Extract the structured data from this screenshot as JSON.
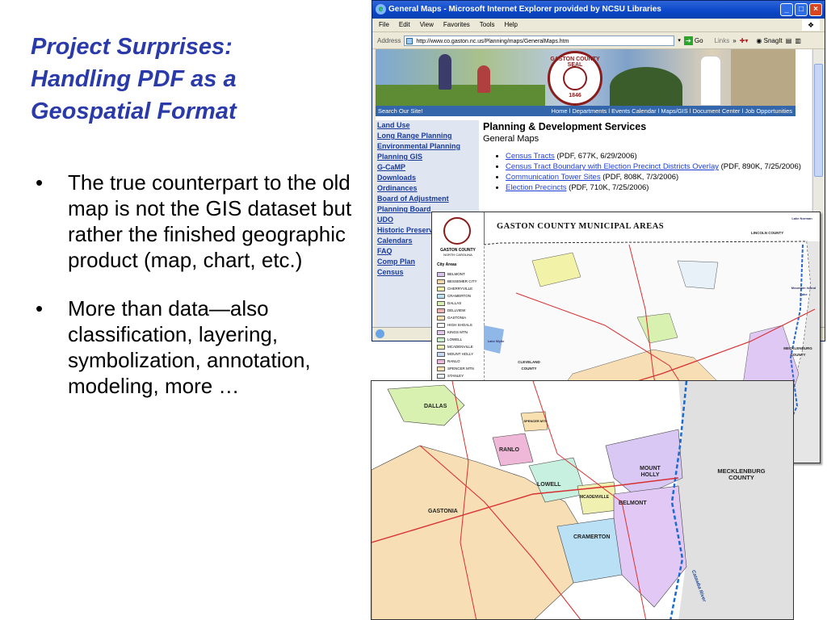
{
  "slide": {
    "title_lines": [
      "Project Surprises:",
      "Handling PDF as a",
      "Geospatial Format"
    ],
    "bullets": [
      "The true counterpart to the old map is not the GIS dataset but rather the finished geographic product (map, chart, etc.)",
      "More than data—also classification, layering, symbolization, annotation, modeling, more …"
    ],
    "bullet_char": "•"
  },
  "browser": {
    "title": "General Maps - Microsoft Internet Explorer provided by NCSU Libraries",
    "menu": [
      "File",
      "Edit",
      "View",
      "Favorites",
      "Tools",
      "Help"
    ],
    "address_label": "Address",
    "url": "http://www.co.gaston.nc.us/Planning/maps/GeneralMaps.htm",
    "go_label": "Go",
    "links_label": "Links",
    "snagit_label": "SnagIt",
    "page": {
      "seal_text": "GASTON COUNTY SEAL",
      "seal_year": "1846",
      "search_link": "Search Our Site!",
      "top_links": "Home l Departments l Events Calendar l Maps/GIS l Document Center l Job Opportunities",
      "left_nav": [
        "Land Use",
        "Long Range Planning",
        "Environmental Planning",
        "Planning GIS",
        "G-CaMP",
        "Downloads",
        "Ordinances",
        "Board of Adjustment",
        "Planning Board",
        "UDO",
        "Historic Preservation",
        "Calendars",
        "FAQ",
        "Comp Plan",
        "Census"
      ],
      "heading": "Planning & Development Services",
      "subheading": "General Maps",
      "links": [
        {
          "link": "Census Tracts",
          "info": "(PDF, 677K, 6/29/2006)"
        },
        {
          "link": "Census Tract Boundary with Election Precinct Districts Overlay",
          "info": "(PDF, 890K, 7/25/2006)"
        },
        {
          "link": "Communication Tower Sites",
          "info": "(PDF, 808K, 7/3/2006)"
        },
        {
          "link": "Election Precincts",
          "info": "(PDF, 710K, 7/25/2006)"
        }
      ]
    }
  },
  "map1": {
    "title": "GASTON COUNTY MUNICIPAL AREAS",
    "legend_county": "GASTON COUNTY",
    "legend_sub": "NORTH CAROLINA",
    "legend_heading": "City Areas",
    "legend": [
      {
        "name": "BELMONT",
        "color": "#d9c3f0"
      },
      {
        "name": "BESSEMER CITY",
        "color": "#f6d8a8"
      },
      {
        "name": "CHERRYVILLE",
        "color": "#f2f2a8"
      },
      {
        "name": "CRAMERTON",
        "color": "#b9e6f0"
      },
      {
        "name": "DALLAS",
        "color": "#d8f0b0"
      },
      {
        "name": "DELLVIEW",
        "color": "#f4b0b0"
      },
      {
        "name": "GASTONIA",
        "color": "#f7deb4"
      },
      {
        "name": "HIGH SHOALS",
        "color": "#ffffff"
      },
      {
        "name": "KINGS MTN",
        "color": "#e4c8f0"
      },
      {
        "name": "LOWELL",
        "color": "#c8f0c8"
      },
      {
        "name": "MCADENVILLE",
        "color": "#f0f0b0"
      },
      {
        "name": "MOUNT HOLLY",
        "color": "#c8d8f8"
      },
      {
        "name": "RANLO",
        "color": "#f0b8d8"
      },
      {
        "name": "SPENCER MTN",
        "color": "#f8e0b0"
      },
      {
        "name": "STANLEY",
        "color": "#e8f0f8"
      }
    ],
    "labels": {
      "lincoln": "LINCOLN COUNTY",
      "meck": "MECKLENBURG COUNTY",
      "cleveland": "CLEVELAND COUNTY",
      "lake": "Lake Norman",
      "lake2": "Mountain Island Lake",
      "wylie": "Lake Wylie"
    }
  },
  "map2": {
    "labels": {
      "dallas": "DALLAS",
      "ranlo": "RANLO",
      "spencer": "SPENCER MTN",
      "lowell": "LOWELL",
      "mcadenville": "MCADENVILLE",
      "mtholly": "MOUNT HOLLY",
      "belmont": "BELMONT",
      "gastonia": "GASTONIA",
      "cramerton": "CRAMERTON",
      "meck": "MECKLENBURG COUNTY",
      "river": "Catawba River"
    },
    "colors": {
      "gastonia": "#f7deb4",
      "dallas": "#d8f0b0",
      "ranlo": "#f0b8d8",
      "lowell": "#c8f0e0",
      "mcadenville": "#f0f0b0",
      "mtholly": "#d9c8f4",
      "belmont": "#e2c8f4",
      "cramerton": "#b9e0f4",
      "meck": "#e0e0e0",
      "river": "#1a6ad0",
      "roads": "#d83030"
    }
  }
}
